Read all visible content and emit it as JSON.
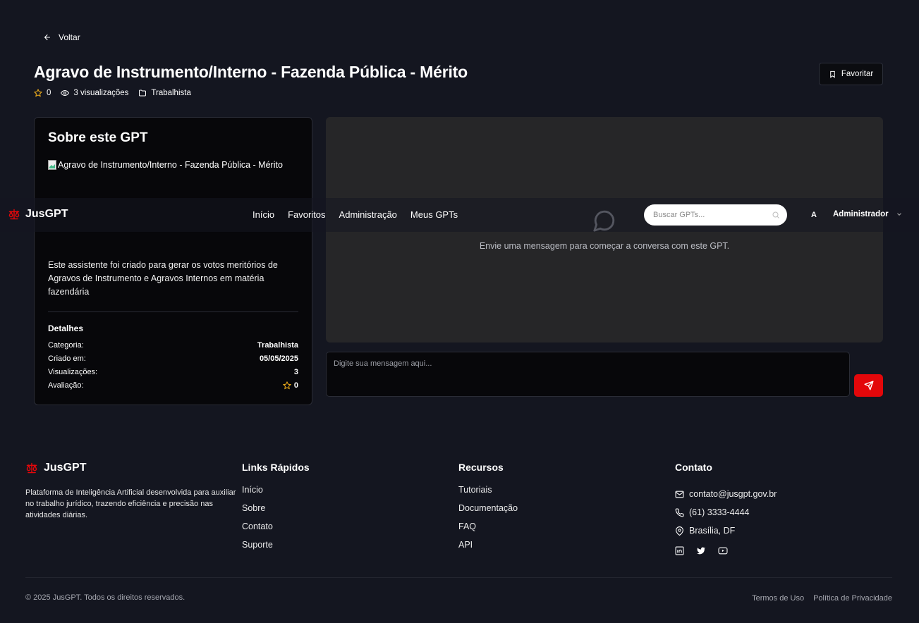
{
  "back": {
    "label": "Voltar"
  },
  "gpt": {
    "title": "Agravo de Instrumento/Interno - Fazenda Pública - Mérito",
    "rating": "0",
    "views_text": "3 visualizações",
    "category": "Trabalhista",
    "favorite_label": "Favoritar"
  },
  "about": {
    "heading": "Sobre este GPT",
    "image_alt": "Agravo de Instrumento/Interno - Fazenda Pública - Mérito",
    "description": "Este assistente foi criado para gerar os votos meritórios de Agravos de Instrumento e Agravos Internos em matéria fazendária",
    "details_title": "Detalhes",
    "details": [
      {
        "label": "Categoria:",
        "value": "Trabalhista"
      },
      {
        "label": "Criado em:",
        "value": "05/05/2025"
      },
      {
        "label": "Visualizações:",
        "value": "3"
      },
      {
        "label": "Avaliação:",
        "value": "0"
      }
    ]
  },
  "chat": {
    "empty_message": "Envie uma mensagem para começar a conversa com este GPT.",
    "input_placeholder": "Digite sua mensagem aqui..."
  },
  "nav": {
    "brand": "JusGPT",
    "links": [
      "Início",
      "Favoritos",
      "Administração",
      "Meus GPTs"
    ],
    "search_placeholder": "Buscar GPTs...",
    "avatar_initial": "A",
    "user_name": "Administrador"
  },
  "footer": {
    "brand": "JusGPT",
    "about": "Plataforma de Inteligência Artificial desenvolvida para auxiliar no trabalho jurídico, trazendo eficiência e precisão nas atividades diárias.",
    "quick_links": {
      "title": "Links Rápidos",
      "items": [
        "Início",
        "Sobre",
        "Contato",
        "Suporte"
      ]
    },
    "resources": {
      "title": "Recursos",
      "items": [
        "Tutoriais",
        "Documentação",
        "FAQ",
        "API"
      ]
    },
    "contact": {
      "title": "Contato",
      "email": "contato@jusgpt.gov.br",
      "phone": "(61) 3333-4444",
      "location": "Brasília, DF"
    },
    "copyright": "© 2025 JusGPT. Todos os direitos reservados.",
    "terms": "Termos de Uso",
    "privacy": "Política de Privacidade"
  },
  "colors": {
    "accent": "#e3070a",
    "star": "#f5b21b",
    "background": "#141620",
    "card": "#07070a",
    "chat_panel": "#262628"
  },
  "icons": [
    "arrow-left-icon",
    "star-icon",
    "eye-icon",
    "folder-icon",
    "bookmark-icon",
    "broken-image-icon",
    "chat-bubble-icon",
    "send-icon",
    "scales-icon",
    "search-icon",
    "chevron-down-icon",
    "mail-icon",
    "phone-icon",
    "map-pin-icon",
    "linkedin-icon",
    "twitter-icon",
    "youtube-icon"
  ]
}
